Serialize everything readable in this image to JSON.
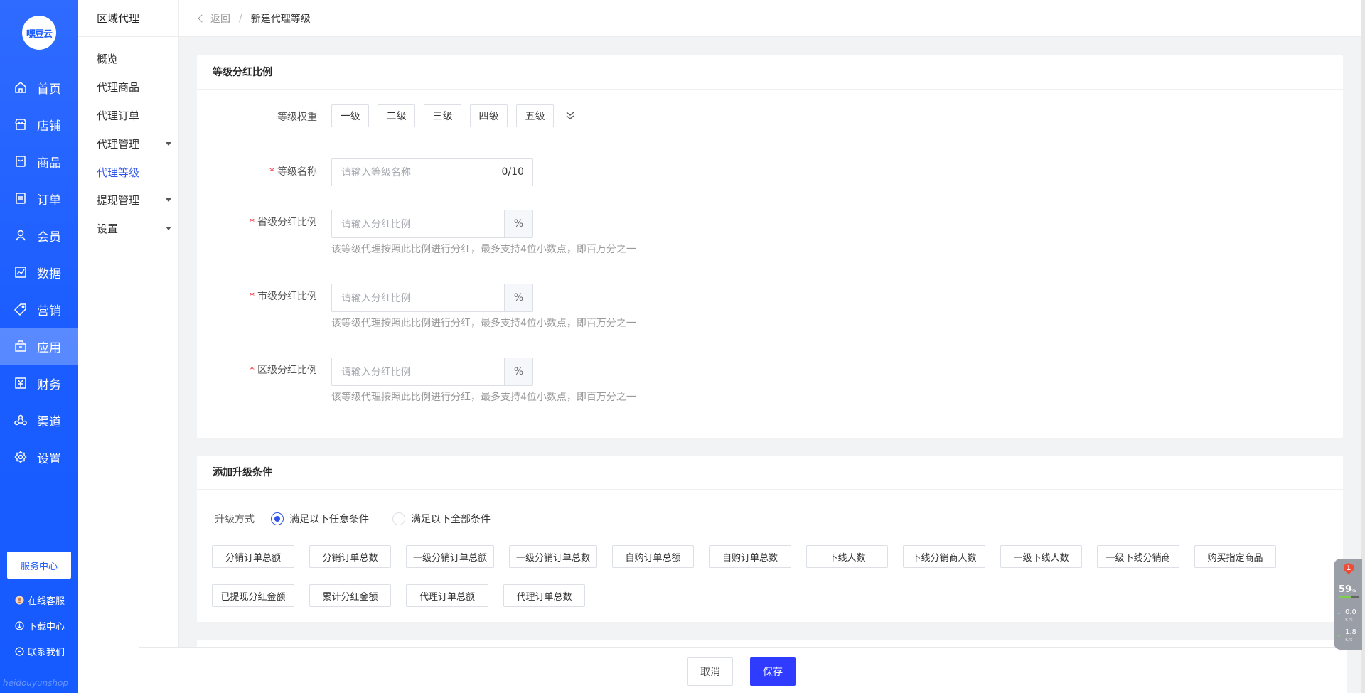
{
  "brand": {
    "logo_text": "嘿豆云",
    "footer_text": "heidouyunshop"
  },
  "nav": {
    "items": [
      {
        "label": "首页",
        "icon": "home-icon"
      },
      {
        "label": "店铺",
        "icon": "store-icon"
      },
      {
        "label": "商品",
        "icon": "goods-icon"
      },
      {
        "label": "订单",
        "icon": "order-icon"
      },
      {
        "label": "会员",
        "icon": "member-icon"
      },
      {
        "label": "数据",
        "icon": "data-icon"
      },
      {
        "label": "营销",
        "icon": "tag-icon"
      },
      {
        "label": "应用",
        "icon": "app-icon"
      },
      {
        "label": "财务",
        "icon": "finance-icon"
      },
      {
        "label": "渠道",
        "icon": "channel-icon"
      },
      {
        "label": "设置",
        "icon": "gear-icon"
      }
    ],
    "active": "应用",
    "service_center": "服务中心",
    "online_service": "在线客服",
    "download_center": "下载中心",
    "contact_us": "联系我们"
  },
  "subnav": {
    "title": "区域代理",
    "items": [
      {
        "label": "概览"
      },
      {
        "label": "代理商品"
      },
      {
        "label": "代理订单"
      },
      {
        "label": "代理管理"
      },
      {
        "label": "代理等级"
      },
      {
        "label": "提现管理"
      },
      {
        "label": "设置"
      }
    ],
    "active": "代理等级"
  },
  "header": {
    "back": "返回",
    "separator": "/",
    "current": "新建代理等级"
  },
  "dividend": {
    "title": "等级分红比例",
    "weight_label": "等级权重",
    "levels": [
      "一级",
      "二级",
      "三级",
      "四级",
      "五级"
    ],
    "name_label": "等级名称",
    "name_placeholder": "请输入等级名称",
    "name_count": "0/10",
    "province_label": "省级分红比例",
    "city_label": "市级分红比例",
    "district_label": "区级分红比例",
    "ratio_placeholder": "请输入分红比例",
    "unit": "%",
    "hint": "该等级代理按照此比例进行分红，最多支持4位小数点，即百万分之一"
  },
  "upgrade": {
    "title": "添加升级条件",
    "mode_label": "升级方式",
    "option_any": "满足以下任意条件",
    "option_all": "满足以下全部条件",
    "selected": "满足以下任意条件",
    "row1": [
      "分销订单总额",
      "分销订单总数",
      "一级分销订单总额",
      "一级分销订单总数",
      "自购订单总额",
      "自购订单总数",
      "下线人数",
      "下线分销商人数",
      "一级下线人数",
      "一级下线分销商",
      "购买指定商品"
    ],
    "row2": [
      "已提现分红金额",
      "累计分红金额",
      "代理订单总额",
      "代理订单总数"
    ]
  },
  "footer": {
    "cancel": "取消",
    "save": "保存"
  },
  "widget": {
    "badge": "1",
    "percent": "59",
    "percent_unit": "%",
    "usage": 0.59,
    "up_speed": "0.0",
    "down_speed": "1.8",
    "speed_unit": "K/s"
  },
  "colors": {
    "primary": "#2f54eb",
    "nav_bg": "#1f5fff",
    "save_btn": "#2f3bff",
    "required": "#f5222d"
  }
}
